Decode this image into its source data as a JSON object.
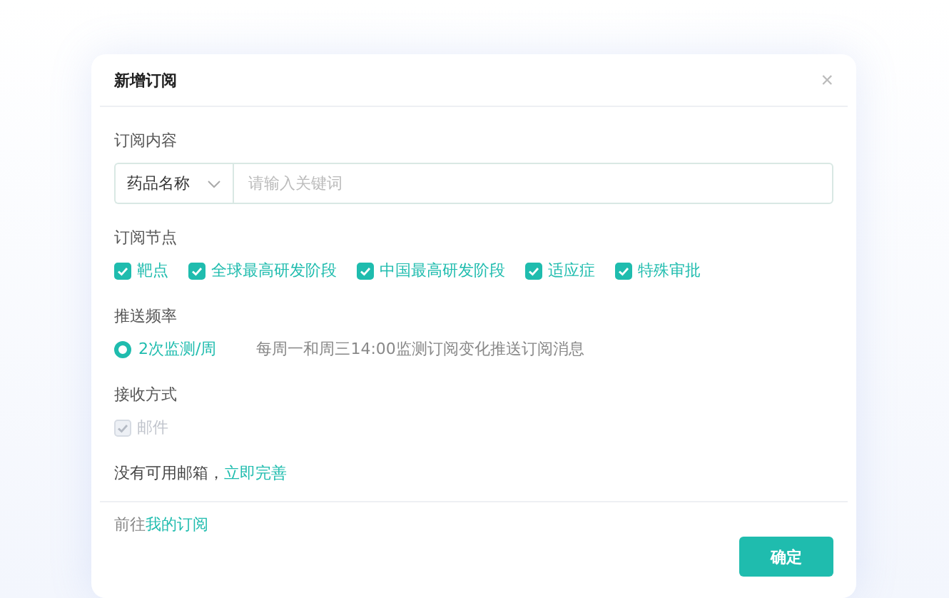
{
  "dialog": {
    "title": "新增订阅",
    "close": "×"
  },
  "content": {
    "label": "订阅内容",
    "type_select": {
      "value": "药品名称"
    },
    "keyword": {
      "placeholder": "请输入关键词"
    }
  },
  "nodes": {
    "label": "订阅节点",
    "options": [
      {
        "label": "靶点",
        "checked": true
      },
      {
        "label": "全球最高研发阶段",
        "checked": true
      },
      {
        "label": "中国最高研发阶段",
        "checked": true
      },
      {
        "label": "适应症",
        "checked": true
      },
      {
        "label": "特殊审批",
        "checked": true
      }
    ]
  },
  "frequency": {
    "label": "推送频率",
    "options": [
      {
        "label": "2次监测/周",
        "selected": true,
        "description": "每周一和周三14:00监测订阅变化推送订阅消息"
      }
    ]
  },
  "delivery": {
    "label": "接收方式",
    "options": [
      {
        "label": "邮件",
        "checked": true,
        "disabled": true
      }
    ],
    "notice": "没有可用邮箱，",
    "notice_link": "立即完善"
  },
  "footer": {
    "prefix": "前往",
    "link": "我的订阅",
    "confirm": "确定"
  }
}
